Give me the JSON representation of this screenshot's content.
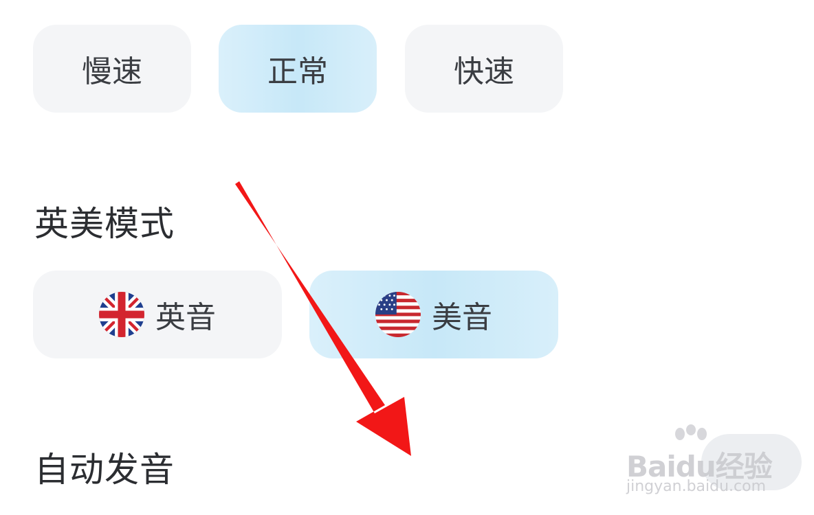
{
  "speed": {
    "options": [
      {
        "label": "慢速",
        "selected": false
      },
      {
        "label": "正常",
        "selected": true
      },
      {
        "label": "快速",
        "selected": false
      }
    ]
  },
  "accent_mode": {
    "title": "英美模式",
    "options": [
      {
        "label": "英音",
        "flag_icon": "uk-flag-icon",
        "selected": false
      },
      {
        "label": "美音",
        "flag_icon": "us-flag-icon",
        "selected": true
      }
    ]
  },
  "auto_pronounce": {
    "title": "自动发音",
    "toggle_on": false
  },
  "annotation": {
    "color": "#f21717",
    "icon": "red-arrow-annotation"
  },
  "watermark": {
    "logo": "Baidu经验",
    "url": "jingyan.baidu.com"
  },
  "colors": {
    "selected_bg": "#d2ecf9",
    "unselected_bg": "#f4f5f7"
  }
}
